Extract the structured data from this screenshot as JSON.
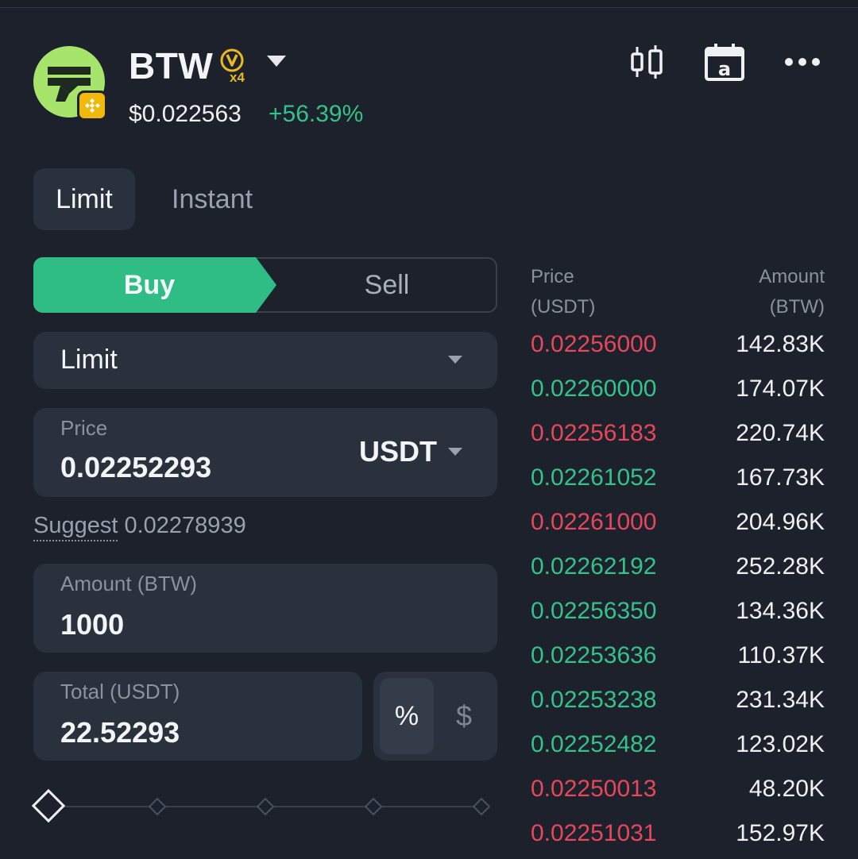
{
  "header": {
    "token_name": "BTW",
    "vip_level": "x4",
    "price": "$0.022563",
    "change": "+56.39%",
    "icons": [
      "token-logo",
      "bnb-chain-badge",
      "vip-badge",
      "dropdown-caret",
      "candlestick-chart-icon",
      "calendar-icon",
      "more-icon"
    ]
  },
  "tabs": {
    "limit": "Limit",
    "instant": "Instant"
  },
  "side": {
    "buy": "Buy",
    "sell": "Sell"
  },
  "order_type": {
    "value": "Limit"
  },
  "price_field": {
    "label": "Price",
    "value": "0.02252293",
    "unit": "USDT"
  },
  "suggest": {
    "label": "Suggest",
    "value": "0.02278939"
  },
  "amount_field": {
    "label": "Amount (BTW)",
    "value": "1000"
  },
  "total_field": {
    "label": "Total (USDT)",
    "value": "22.52293"
  },
  "toggle": {
    "percent": "%",
    "dollar": "$"
  },
  "slider": {
    "value_percent": 0
  },
  "orderbook": {
    "price_header_1": "Price",
    "price_header_2": "(USDT)",
    "amount_header_1": "Amount",
    "amount_header_2": "(BTW)",
    "rows": [
      {
        "price": "0.02256000",
        "amount": "142.83K",
        "side": "ask"
      },
      {
        "price": "0.02260000",
        "amount": "174.07K",
        "side": "bid"
      },
      {
        "price": "0.02256183",
        "amount": "220.74K",
        "side": "ask"
      },
      {
        "price": "0.02261052",
        "amount": "167.73K",
        "side": "bid"
      },
      {
        "price": "0.02261000",
        "amount": "204.96K",
        "side": "ask"
      },
      {
        "price": "0.02262192",
        "amount": "252.28K",
        "side": "bid"
      },
      {
        "price": "0.02256350",
        "amount": "134.36K",
        "side": "bid"
      },
      {
        "price": "0.02253636",
        "amount": "110.37K",
        "side": "bid"
      },
      {
        "price": "0.02253238",
        "amount": "231.34K",
        "side": "bid"
      },
      {
        "price": "0.02252482",
        "amount": "123.02K",
        "side": "bid"
      },
      {
        "price": "0.02250013",
        "amount": "48.20K",
        "side": "ask"
      },
      {
        "price": "0.02251031",
        "amount": "152.97K",
        "side": "ask"
      }
    ]
  },
  "colors": {
    "bid": "#35c28a",
    "ask": "#e6475b",
    "buy_button": "#2fbd85",
    "background": "#1c212b",
    "field": "#2a303c"
  }
}
